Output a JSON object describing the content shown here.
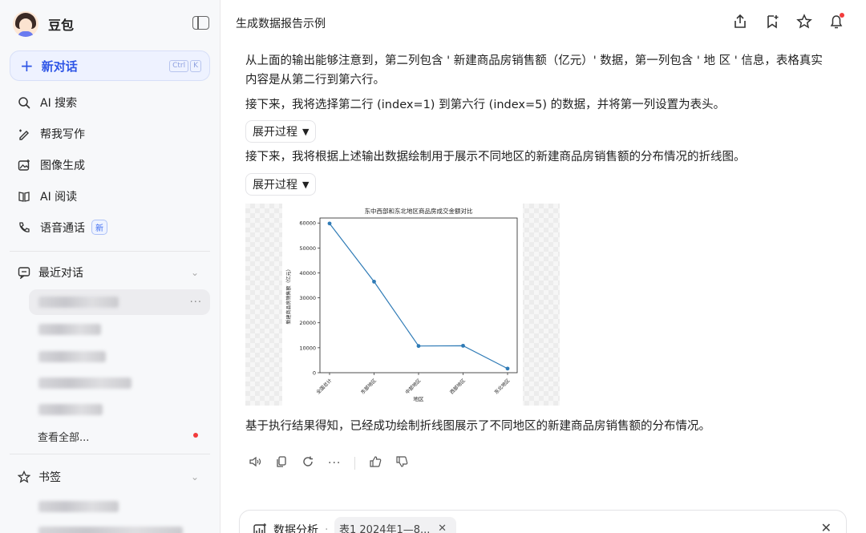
{
  "sidebar": {
    "brand": "豆包",
    "new_chat": "新对话",
    "shortcut": [
      "Ctrl",
      "K"
    ],
    "nav": [
      {
        "label": "AI 搜索",
        "icon": "ai-search-icon"
      },
      {
        "label": "帮我写作",
        "icon": "pen-icon"
      },
      {
        "label": "图像生成",
        "icon": "image-generate-icon"
      },
      {
        "label": "AI 阅读",
        "icon": "reading-icon"
      },
      {
        "label": "语音通话",
        "icon": "phone-icon",
        "badge": "新"
      }
    ],
    "recent_title": "最近对话",
    "view_all": "查看全部...",
    "bookmarks_title": "书签"
  },
  "topbar": {
    "title": "生成数据报告示例"
  },
  "content": {
    "para1": "从上面的输出能够注意到，第二列包含 ' 新建商品房销售额（亿元）' 数据，第一列包含 ' 地 区 ' 信息，表格真实内容是从第二行到第六行。",
    "para2": "接下来，我将选择第二行 (index=1) 到第六行 (index=5) 的数据，并将第一列设置为表头。",
    "expand1": "展开过程",
    "para3": "接下来，我将根据上述输出数据绘制用于展示不同地区的新建商品房销售额的分布情况的折线图。",
    "expand2": "展开过程",
    "para4": "基于执行结果得知，已经成功绘制折线图展示了不同地区的新建商品房销售额的分布情况。"
  },
  "chart_data": {
    "type": "line",
    "title": "东中西部和东北地区商品房成交金额对比",
    "xlabel": "地区",
    "ylabel": "新建商品房销售额（亿元）",
    "categories": [
      "全国总计",
      "东部地区",
      "中部地区",
      "西部地区",
      "东北地区"
    ],
    "values": [
      59800,
      36500,
      10700,
      10800,
      1650
    ],
    "ylim": [
      0,
      62000
    ],
    "yticks": [
      0,
      10000,
      20000,
      30000,
      40000,
      50000,
      60000
    ],
    "color": "#2f7bb6",
    "grid": false
  },
  "input": {
    "tool_label": "数据分析",
    "separator": "·",
    "chip": "表1 2024年1—8..."
  }
}
